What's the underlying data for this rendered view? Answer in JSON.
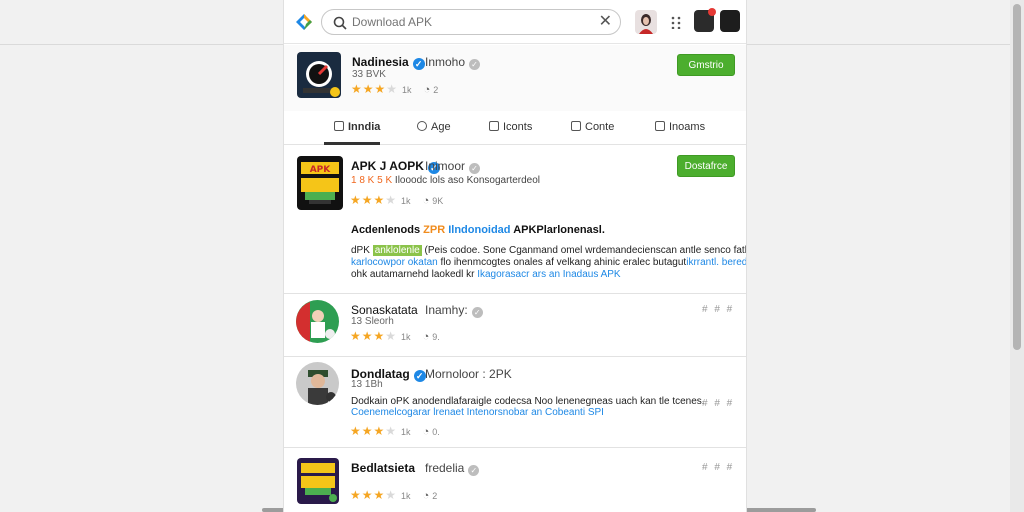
{
  "search": {
    "placeholder": "Download APK",
    "clear_icon": "close-icon"
  },
  "header_app": {
    "name": "Nadinesia",
    "developer": "Inmoho",
    "version": "33 BVK",
    "rating": 3,
    "rating_count": "1k",
    "comments": "2",
    "action": "Gmstrio"
  },
  "tabs": [
    {
      "label": "Inndia",
      "icon": "document-icon",
      "active": true
    },
    {
      "label": "Age",
      "icon": "chat-icon"
    },
    {
      "label": "Iconts",
      "icon": "square-icon"
    },
    {
      "label": "Conte",
      "icon": "chart-icon"
    },
    {
      "label": "Inoams",
      "icon": "square-icon"
    }
  ],
  "featured": {
    "name": "APK J AOPK",
    "developer": "Inimoor",
    "sub_orange": "1 8 K 5 K",
    "sub_text": "Ilooodc lols aso Konsogarterdeol",
    "rating": 3,
    "rating_count": "1k",
    "comments": "9K",
    "action": "Dostafrce",
    "desc_heading": "Acdenlenods ZPR Ilndonoidad APKPlarlonenasl.",
    "desc_heading_parts": [
      "Acdenlenods",
      "ZPR",
      "Ilndonoidad",
      "APKPlarlonenasl."
    ],
    "desc_lines": [
      {
        "a": "dPK",
        "b": "anklolenle",
        "c": " (Peis codoe. Sone Cganmand omel wrdemandecienscan antle senco fatlet"
      },
      {
        "a": "karlocowpor okatan",
        "b": " flo ihenmcogtes onales af velkang ahinic eralec butagut",
        "c": "ikrrantl. bered"
      },
      {
        "a": "ohk autamarnehd laokedl kr ",
        "b": "Ikagorasacr ars an Inadaus APK",
        "c": ""
      }
    ]
  },
  "list": [
    {
      "name": "Sonaskatata",
      "developer": "Inamhy:",
      "sub": "13 Sleorh",
      "rating": 3,
      "rating_count": "1k",
      "comments": "9.",
      "hashes": "# # #"
    },
    {
      "name": "Dondlatag",
      "developer": "Mornoloor : 2PK",
      "sub": "13 1Bh",
      "desc1": "Dodkain oPK anodendlafaraigle codecsa Noo lenenegneas uach kan tle tcenes.",
      "desc2": "Coenemelcogarar lrenaet Intenorsnobar an Cobeanti SPI",
      "rating": 3,
      "rating_count": "1k",
      "comments": "0.",
      "hashes": "# # #"
    },
    {
      "name": "Bedlatsieta",
      "developer": "fredelia",
      "rating": 3,
      "rating_count": "1k",
      "comments": "2",
      "hashes": "# # #"
    }
  ]
}
